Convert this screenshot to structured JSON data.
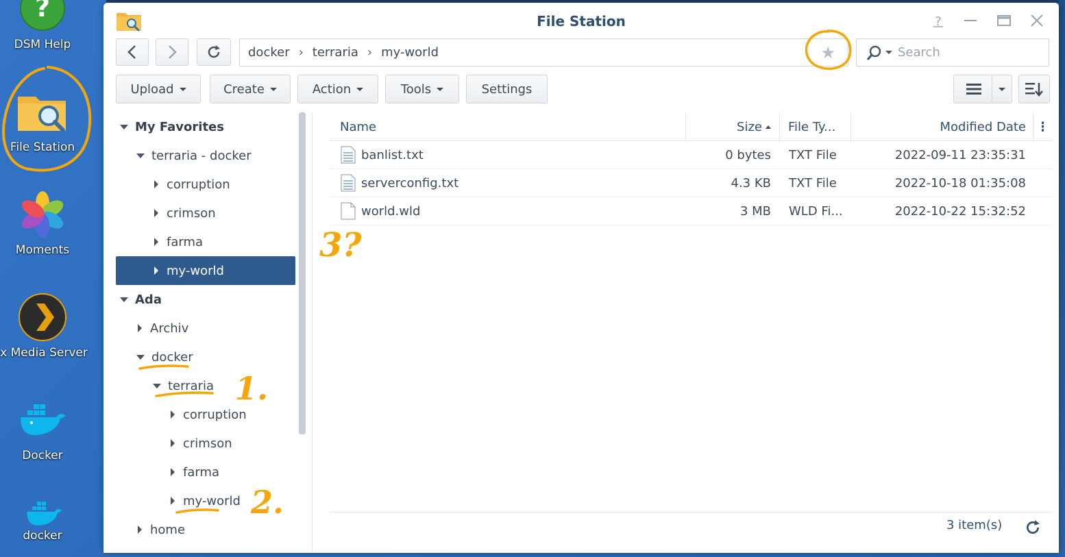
{
  "desktop": {
    "icons": [
      {
        "label": "DSM Help",
        "icon": "help-icon"
      },
      {
        "label": "File Station",
        "icon": "folder-search-icon"
      },
      {
        "label": "Moments",
        "icon": "moments-flower-icon"
      },
      {
        "label": "ex Media Server",
        "icon": "plex-icon"
      },
      {
        "label": "Docker",
        "icon": "docker-whale-icon"
      },
      {
        "label": "docker",
        "icon": "docker-whale-icon"
      }
    ]
  },
  "window": {
    "title": "File Station",
    "controls": {
      "help": "help-icon",
      "minimize": "minimize-icon",
      "maximize": "maximize-icon",
      "close": "close-icon"
    }
  },
  "nav": {
    "back": "chevron-left-icon",
    "forward": "chevron-right-icon",
    "refresh": "refresh-icon"
  },
  "path": {
    "crumbs": [
      "docker",
      "terraria",
      "my-world"
    ],
    "separator": "›"
  },
  "search": {
    "placeholder": "Search"
  },
  "toolbar": {
    "upload": "Upload",
    "create": "Create",
    "action": "Action",
    "tools": "Tools",
    "settings": "Settings"
  },
  "tree": {
    "favorites_title": "My Favorites",
    "favorite_root": "terraria - docker",
    "favorite_children": [
      "corruption",
      "crimson",
      "farma",
      "my-world"
    ],
    "volume_title": "Ada",
    "volume_children": [
      "Archiv",
      "docker"
    ],
    "docker_child": "terraria",
    "terraria_children": [
      "corruption",
      "crimson",
      "farma",
      "my-world"
    ],
    "home": "home"
  },
  "grid": {
    "columns": {
      "name": "Name",
      "size": "Size",
      "type": "File Ty...",
      "modified": "Modified Date"
    },
    "rows": [
      {
        "name": "banlist.txt",
        "size": "0 bytes",
        "type": "TXT File",
        "modified": "2022-09-11 23:35:31",
        "icon": "text-file-icon"
      },
      {
        "name": "serverconfig.txt",
        "size": "4.3 KB",
        "type": "TXT File",
        "modified": "2022-10-18 01:35:08",
        "icon": "text-file-icon"
      },
      {
        "name": "world.wld",
        "size": "3 MB",
        "type": "WLD Fi...",
        "modified": "2022-10-22 15:32:52",
        "icon": "file-icon"
      }
    ],
    "count": "3 item(s)"
  },
  "annotations": {
    "one": "1.",
    "two": "2.",
    "three": "3?"
  },
  "colors": {
    "desktop": "#2a6cbf",
    "selection": "#2e5a8e",
    "title": "#2f4e6f",
    "annotation": "#f5a70a"
  }
}
